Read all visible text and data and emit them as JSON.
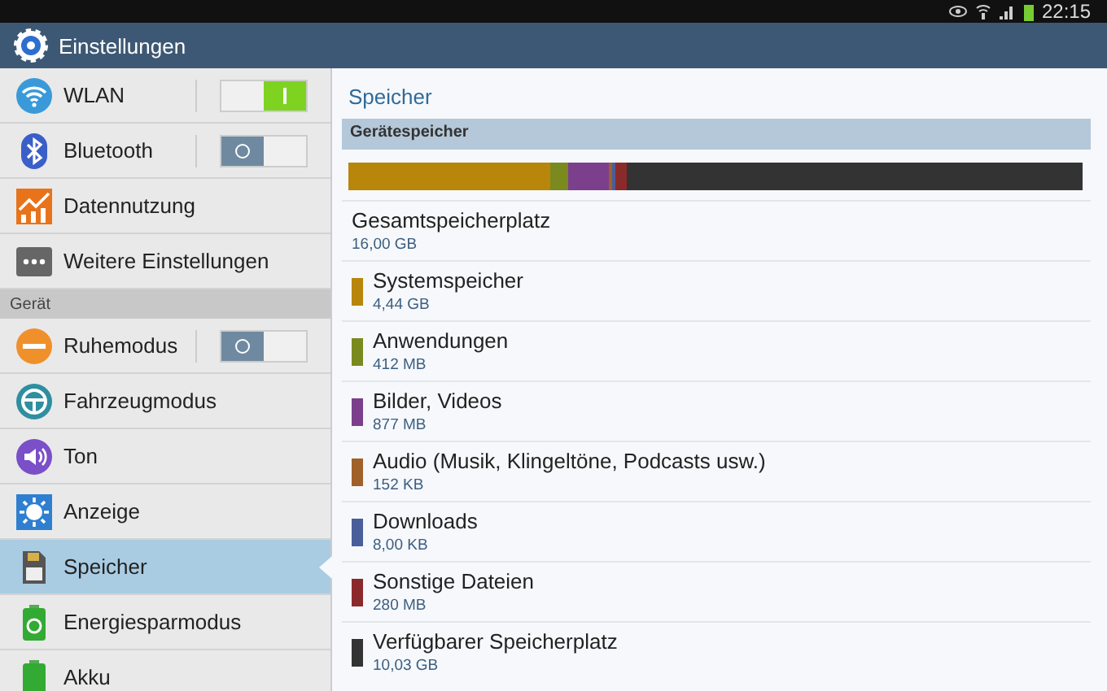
{
  "status_bar": {
    "time": "22:15"
  },
  "header": {
    "title": "Einstellungen"
  },
  "sidebar": {
    "items": [
      {
        "kind": "toggle",
        "label": "WLAN",
        "on": true,
        "selected": false
      },
      {
        "kind": "toggle",
        "label": "Bluetooth",
        "on": false,
        "selected": false
      },
      {
        "kind": "item",
        "label": "Datennutzung",
        "selected": false
      },
      {
        "kind": "item",
        "label": "Weitere Einstellungen",
        "selected": false
      },
      {
        "kind": "section",
        "label": "Gerät"
      },
      {
        "kind": "toggle",
        "label": "Ruhemodus",
        "on": false,
        "selected": false
      },
      {
        "kind": "item",
        "label": "Fahrzeugmodus",
        "selected": false
      },
      {
        "kind": "item",
        "label": "Ton",
        "selected": false
      },
      {
        "kind": "item",
        "label": "Anzeige",
        "selected": false
      },
      {
        "kind": "item",
        "label": "Speicher",
        "selected": true
      },
      {
        "kind": "item",
        "label": "Energiesparmodus",
        "selected": false
      },
      {
        "kind": "item",
        "label": "Akku",
        "selected": false
      }
    ]
  },
  "content": {
    "title": "Speicher",
    "section": "Gerätespeicher",
    "total": {
      "label": "Gesamtspeicherplatz",
      "value": "16,00 GB"
    },
    "categories": [
      {
        "label": "Systemspeicher",
        "value": "4,44 GB",
        "color": "#b8860b"
      },
      {
        "label": "Anwendungen",
        "value": "412 MB",
        "color": "#7a8a1e"
      },
      {
        "label": "Bilder, Videos",
        "value": "877 MB",
        "color": "#7b3f8c"
      },
      {
        "label": "Audio (Musik, Klingeltöne, Podcasts usw.)",
        "value": "152 KB",
        "color": "#a0602a"
      },
      {
        "label": "Downloads",
        "value": "8,00 KB",
        "color": "#4a5e9a"
      },
      {
        "label": "Sonstige Dateien",
        "value": "280 MB",
        "color": "#8b2a2a"
      },
      {
        "label": "Verfügbarer Speicherplatz",
        "value": "10,03 GB",
        "color": "#333333"
      }
    ]
  }
}
